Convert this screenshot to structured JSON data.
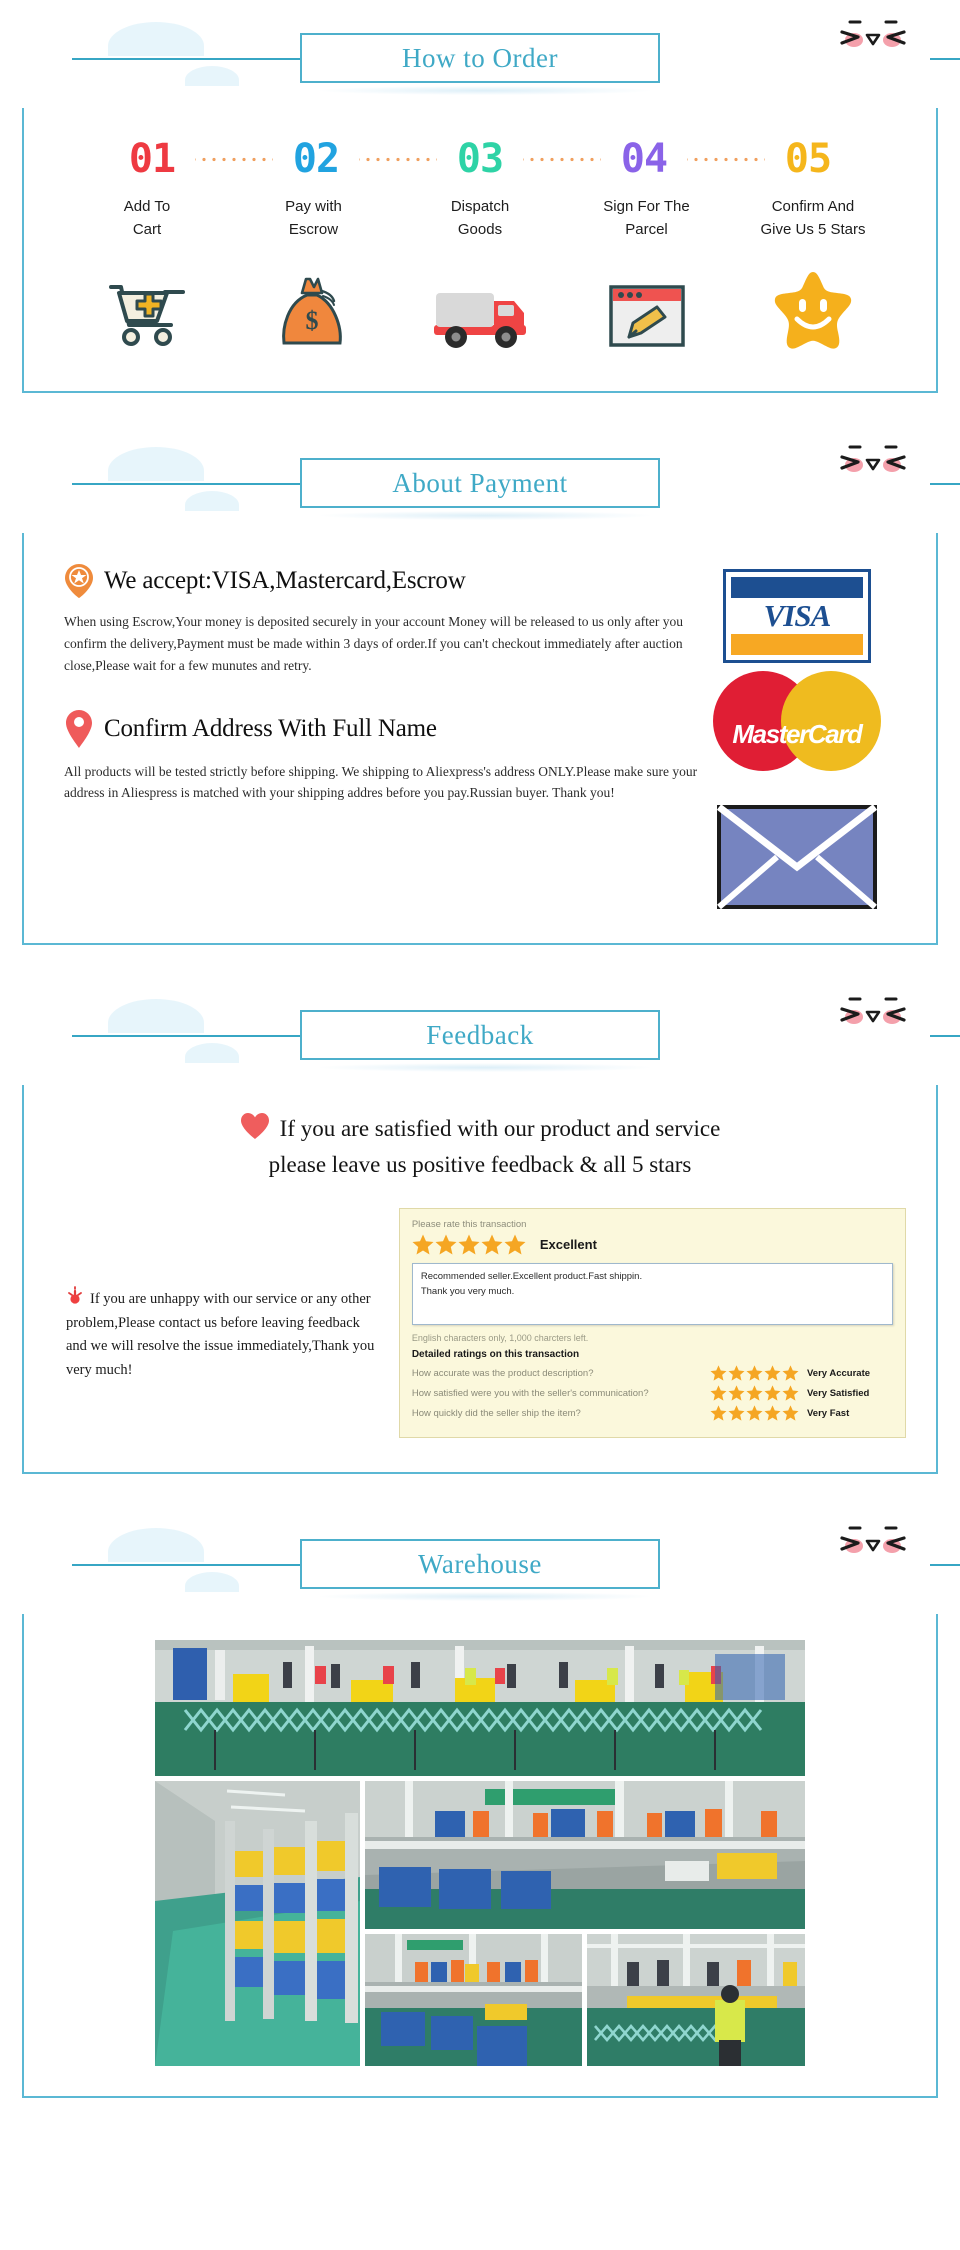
{
  "sections": {
    "order": {
      "title": "How to Order",
      "steps": [
        {
          "num": "01",
          "color": "#ee3a42",
          "label": "Add To\nCart",
          "icon": "shopping-cart-icon"
        },
        {
          "num": "02",
          "color": "#21a3e0",
          "label": "Pay with\nEscrow",
          "icon": "money-bag-icon"
        },
        {
          "num": "03",
          "color": "#2ed3a6",
          "label": "Dispatch\nGoods",
          "icon": "delivery-truck-icon"
        },
        {
          "num": "04",
          "color": "#8a63e8",
          "label": "Sign For The\nParcel",
          "icon": "sign-document-icon"
        },
        {
          "num": "05",
          "color": "#f5b61c",
          "label": "Confirm And\nGive Us 5 Stars",
          "icon": "smiling-star-icon"
        }
      ]
    },
    "payment": {
      "title": "About Payment",
      "accept_heading": "We accept:VISA,Mastercard,Escrow",
      "accept_text": "When using Escrow,Your money is deposited securely in your account Money will be released to us only after you confirm the delivery,Payment must be made within 3 days of order.If you can't checkout immediately after auction close,Please wait for a few munutes and retry.",
      "address_heading": "Confirm Address With Full Name",
      "address_text": "All products will be tested strictly before shipping. We shipping to Aliexpress's address ONLY.Please make sure your address in Aliespress is matched with your shipping addres before you pay.Russian buyer. Thank you!",
      "logos": {
        "visa": "VISA",
        "mastercard": "MasterCard",
        "envelope_icon": "envelope-icon"
      }
    },
    "feedback": {
      "title": "Feedback",
      "headline_line1": "If you are satisfied with our product and service",
      "headline_line2": "please leave us positive feedback & all 5 stars",
      "unhappy_text": "If you are unhappy with our service or any other problem,Please contact us before leaving feedback and we will resolve the issue immediately,Thank you very much!",
      "rate_card": {
        "prompt": "Please rate this transaction",
        "rating_stars": 5,
        "rating_label": "Excellent",
        "comment_line1": "Recommended seller.Excellent product.Fast shippin.",
        "comment_line2": "Thank you very much.",
        "char_note": "English characters only, 1,000 charcters left.",
        "detail_title": "Detailed ratings on this transaction",
        "details": [
          {
            "question": "How accurate was the product description?",
            "stars": 5,
            "answer": "Very Accurate"
          },
          {
            "question": "How satisfied were you with the seller's communication?",
            "stars": 5,
            "answer": "Very Satisfied"
          },
          {
            "question": "How quickly did the seller ship the item?",
            "stars": 5,
            "answer": "Very Fast"
          }
        ]
      }
    },
    "warehouse": {
      "title": "Warehouse",
      "photos": [
        {
          "name": "warehouse-photo-packing-line"
        },
        {
          "name": "warehouse-photo-storage-aisle"
        },
        {
          "name": "warehouse-photo-conveyor-sorting"
        },
        {
          "name": "warehouse-photo-assembly-row"
        },
        {
          "name": "warehouse-photo-worker-station"
        }
      ]
    }
  },
  "theme": {
    "accent": "#3fa9c6",
    "border": "#5bb8d4",
    "dots": "#f0a060",
    "star_gold": "#f5a623"
  }
}
